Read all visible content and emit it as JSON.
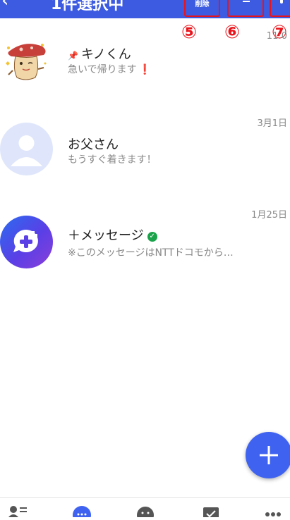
{
  "header": {
    "back_glyph": "‹",
    "selection_title": "1件選択中",
    "delete_label": "削除",
    "accent_color": "#3d5be0"
  },
  "callouts": [
    "⑤",
    "⑥",
    "⑦"
  ],
  "conversations": [
    {
      "name": "キノくん",
      "preview": "急いで帰ります",
      "emphasis": "❗",
      "date": "11:0",
      "pinned": true,
      "avatar": "kinoko-mascot"
    },
    {
      "name": "お父さん",
      "preview": "もうすぐ着きます！",
      "date": "3月1日",
      "pinned": false,
      "avatar": "default-person"
    },
    {
      "name": "＋メッセージ",
      "preview": "※このメッセージはNTTドコモから…",
      "date": "1月25日",
      "verified": true,
      "avatar": "plus-message-logo"
    }
  ],
  "fab": {
    "icon": "plus-icon"
  },
  "bottom_nav": [
    "contacts-icon",
    "chat-icon",
    "stamp-icon",
    "task-icon",
    "more-icon"
  ]
}
